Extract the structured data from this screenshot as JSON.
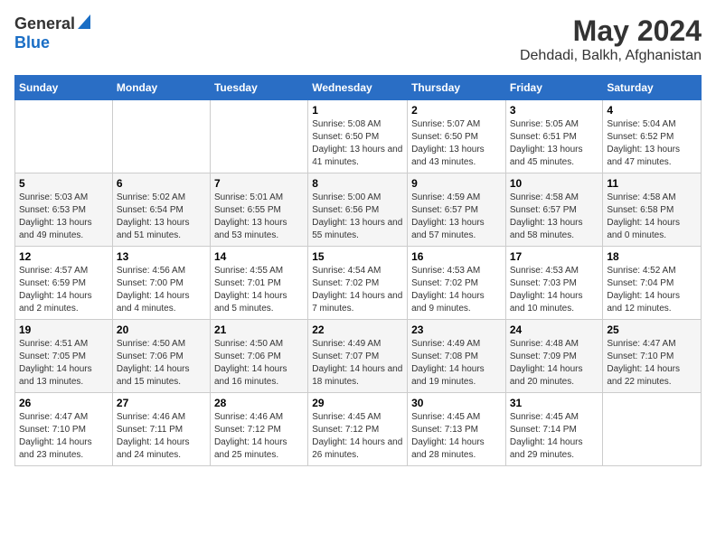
{
  "header": {
    "logo_general": "General",
    "logo_blue": "Blue",
    "title": "May 2024",
    "subtitle": "Dehdadi, Balkh, Afghanistan"
  },
  "weekdays": [
    "Sunday",
    "Monday",
    "Tuesday",
    "Wednesday",
    "Thursday",
    "Friday",
    "Saturday"
  ],
  "weeks": [
    [
      {
        "day": "",
        "info": ""
      },
      {
        "day": "",
        "info": ""
      },
      {
        "day": "",
        "info": ""
      },
      {
        "day": "1",
        "info": "Sunrise: 5:08 AM\nSunset: 6:50 PM\nDaylight: 13 hours\nand 41 minutes."
      },
      {
        "day": "2",
        "info": "Sunrise: 5:07 AM\nSunset: 6:50 PM\nDaylight: 13 hours\nand 43 minutes."
      },
      {
        "day": "3",
        "info": "Sunrise: 5:05 AM\nSunset: 6:51 PM\nDaylight: 13 hours\nand 45 minutes."
      },
      {
        "day": "4",
        "info": "Sunrise: 5:04 AM\nSunset: 6:52 PM\nDaylight: 13 hours\nand 47 minutes."
      }
    ],
    [
      {
        "day": "5",
        "info": "Sunrise: 5:03 AM\nSunset: 6:53 PM\nDaylight: 13 hours\nand 49 minutes."
      },
      {
        "day": "6",
        "info": "Sunrise: 5:02 AM\nSunset: 6:54 PM\nDaylight: 13 hours\nand 51 minutes."
      },
      {
        "day": "7",
        "info": "Sunrise: 5:01 AM\nSunset: 6:55 PM\nDaylight: 13 hours\nand 53 minutes."
      },
      {
        "day": "8",
        "info": "Sunrise: 5:00 AM\nSunset: 6:56 PM\nDaylight: 13 hours\nand 55 minutes."
      },
      {
        "day": "9",
        "info": "Sunrise: 4:59 AM\nSunset: 6:57 PM\nDaylight: 13 hours\nand 57 minutes."
      },
      {
        "day": "10",
        "info": "Sunrise: 4:58 AM\nSunset: 6:57 PM\nDaylight: 13 hours\nand 58 minutes."
      },
      {
        "day": "11",
        "info": "Sunrise: 4:58 AM\nSunset: 6:58 PM\nDaylight: 14 hours\nand 0 minutes."
      }
    ],
    [
      {
        "day": "12",
        "info": "Sunrise: 4:57 AM\nSunset: 6:59 PM\nDaylight: 14 hours\nand 2 minutes."
      },
      {
        "day": "13",
        "info": "Sunrise: 4:56 AM\nSunset: 7:00 PM\nDaylight: 14 hours\nand 4 minutes."
      },
      {
        "day": "14",
        "info": "Sunrise: 4:55 AM\nSunset: 7:01 PM\nDaylight: 14 hours\nand 5 minutes."
      },
      {
        "day": "15",
        "info": "Sunrise: 4:54 AM\nSunset: 7:02 PM\nDaylight: 14 hours\nand 7 minutes."
      },
      {
        "day": "16",
        "info": "Sunrise: 4:53 AM\nSunset: 7:02 PM\nDaylight: 14 hours\nand 9 minutes."
      },
      {
        "day": "17",
        "info": "Sunrise: 4:53 AM\nSunset: 7:03 PM\nDaylight: 14 hours\nand 10 minutes."
      },
      {
        "day": "18",
        "info": "Sunrise: 4:52 AM\nSunset: 7:04 PM\nDaylight: 14 hours\nand 12 minutes."
      }
    ],
    [
      {
        "day": "19",
        "info": "Sunrise: 4:51 AM\nSunset: 7:05 PM\nDaylight: 14 hours\nand 13 minutes."
      },
      {
        "day": "20",
        "info": "Sunrise: 4:50 AM\nSunset: 7:06 PM\nDaylight: 14 hours\nand 15 minutes."
      },
      {
        "day": "21",
        "info": "Sunrise: 4:50 AM\nSunset: 7:06 PM\nDaylight: 14 hours\nand 16 minutes."
      },
      {
        "day": "22",
        "info": "Sunrise: 4:49 AM\nSunset: 7:07 PM\nDaylight: 14 hours\nand 18 minutes."
      },
      {
        "day": "23",
        "info": "Sunrise: 4:49 AM\nSunset: 7:08 PM\nDaylight: 14 hours\nand 19 minutes."
      },
      {
        "day": "24",
        "info": "Sunrise: 4:48 AM\nSunset: 7:09 PM\nDaylight: 14 hours\nand 20 minutes."
      },
      {
        "day": "25",
        "info": "Sunrise: 4:47 AM\nSunset: 7:10 PM\nDaylight: 14 hours\nand 22 minutes."
      }
    ],
    [
      {
        "day": "26",
        "info": "Sunrise: 4:47 AM\nSunset: 7:10 PM\nDaylight: 14 hours\nand 23 minutes."
      },
      {
        "day": "27",
        "info": "Sunrise: 4:46 AM\nSunset: 7:11 PM\nDaylight: 14 hours\nand 24 minutes."
      },
      {
        "day": "28",
        "info": "Sunrise: 4:46 AM\nSunset: 7:12 PM\nDaylight: 14 hours\nand 25 minutes."
      },
      {
        "day": "29",
        "info": "Sunrise: 4:45 AM\nSunset: 7:12 PM\nDaylight: 14 hours\nand 26 minutes."
      },
      {
        "day": "30",
        "info": "Sunrise: 4:45 AM\nSunset: 7:13 PM\nDaylight: 14 hours\nand 28 minutes."
      },
      {
        "day": "31",
        "info": "Sunrise: 4:45 AM\nSunset: 7:14 PM\nDaylight: 14 hours\nand 29 minutes."
      },
      {
        "day": "",
        "info": ""
      }
    ]
  ]
}
